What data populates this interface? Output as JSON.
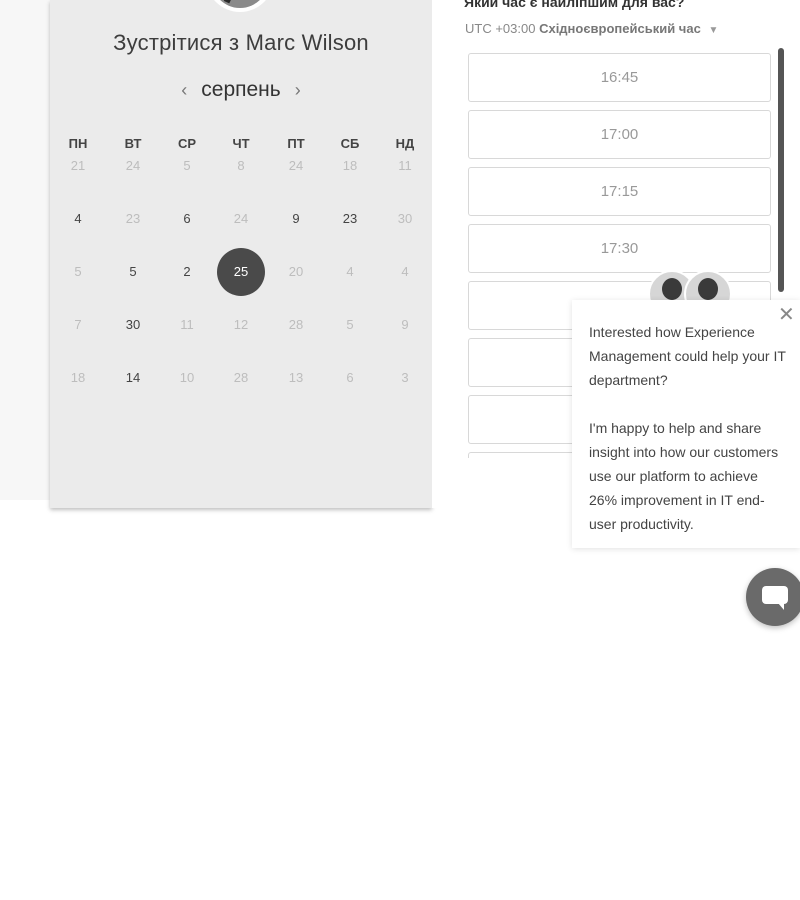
{
  "calendar": {
    "title_prefix": "Зустрітися з",
    "host_name": "Marc Wilson",
    "month": "серпень",
    "prev_icon": "chevron-left-icon",
    "next_icon": "chevron-right-icon",
    "weekdays": [
      "ПН",
      "ВТ",
      "СР",
      "ЧТ",
      "ПТ",
      "СБ",
      "НД"
    ],
    "weeks": [
      [
        {
          "d": "21",
          "off": true
        },
        {
          "d": "24",
          "off": true
        },
        {
          "d": "5",
          "off": true
        },
        {
          "d": "8",
          "off": true
        },
        {
          "d": "24",
          "off": true
        },
        {
          "d": "18",
          "off": true
        },
        {
          "d": "11",
          "off": true
        }
      ],
      [
        {
          "d": "4",
          "off": false
        },
        {
          "d": "23",
          "off": true
        },
        {
          "d": "6",
          "off": false
        },
        {
          "d": "24",
          "off": true
        },
        {
          "d": "9",
          "off": false
        },
        {
          "d": "23",
          "off": false
        },
        {
          "d": "30",
          "off": true
        }
      ],
      [
        {
          "d": "5",
          "off": true
        },
        {
          "d": "5",
          "off": false
        },
        {
          "d": "2",
          "off": false
        },
        {
          "d": "25",
          "off": false,
          "selected": true
        },
        {
          "d": "20",
          "off": true
        },
        {
          "d": "4",
          "off": true
        },
        {
          "d": "4",
          "off": true
        }
      ],
      [
        {
          "d": "7",
          "off": true
        },
        {
          "d": "30",
          "off": false
        },
        {
          "d": "11",
          "off": true
        },
        {
          "d": "12",
          "off": true
        },
        {
          "d": "28",
          "off": true
        },
        {
          "d": "5",
          "off": true
        },
        {
          "d": "9",
          "off": true
        }
      ],
      [
        {
          "d": "18",
          "off": true
        },
        {
          "d": "14",
          "off": false
        },
        {
          "d": "10",
          "off": true
        },
        {
          "d": "28",
          "off": true
        },
        {
          "d": "13",
          "off": true
        },
        {
          "d": "6",
          "off": true
        },
        {
          "d": "3",
          "off": true
        }
      ]
    ]
  },
  "times": {
    "question": "Який час є найліпшим для вас?",
    "timezone_offset": "UTC +03:00",
    "timezone_name": "Східноєвропейський час",
    "timezone_caret_icon": "caret-down-icon",
    "slots": [
      "16:45",
      "17:00",
      "17:15",
      "17:30",
      "",
      "",
      "",
      ""
    ]
  },
  "chat": {
    "close_icon": "close-icon",
    "message_1": "Interested how Experience Management could help your IT department?",
    "message_2": "I'm happy to help and share insight into how our customers use our platform to achieve 26% improvement in IT end-user productivity.",
    "launcher_icon": "chat-bubble-icon"
  }
}
